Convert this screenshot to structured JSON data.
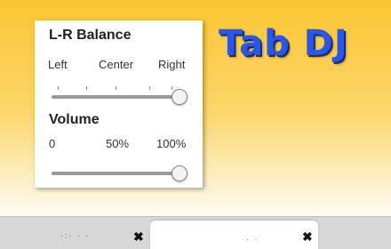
{
  "brand": {
    "title": "Tab DJ"
  },
  "balance": {
    "title": "L-R Balance",
    "labels": [
      "Left",
      "Center",
      "Right"
    ],
    "value": 1.0
  },
  "volume": {
    "title": "Volume",
    "labels": [
      "0",
      "50%",
      "100%"
    ],
    "value": 1.0
  },
  "tabs": {
    "close_glyph": "✖"
  },
  "colors": {
    "brand_blue": "#2b57e6",
    "background_top": "#fbc634",
    "panel": "#ffffff"
  }
}
